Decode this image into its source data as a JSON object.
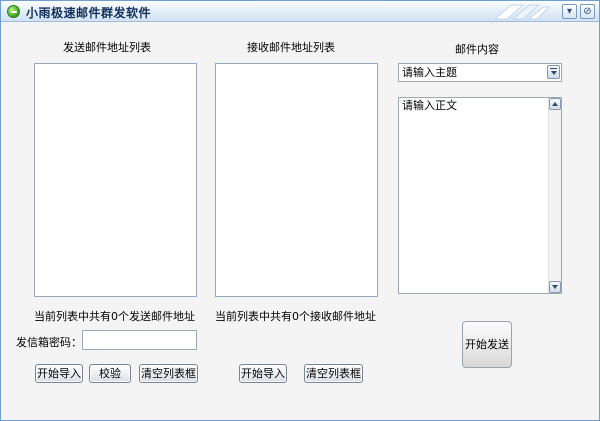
{
  "window": {
    "title": "小雨极速邮件群发软件",
    "minimize_glyph": "▾",
    "close_glyph": "⊘"
  },
  "sender": {
    "header": "发送邮件地址列表",
    "count_text": "当前列表中共有0个发送邮件地址",
    "password_label": "发信箱密码：",
    "password_value": "",
    "import_label": "开始导入",
    "verify_label": "校验",
    "clear_label": "清空列表框"
  },
  "receiver": {
    "header": "接收邮件地址列表",
    "count_text": "当前列表中共有0个接收邮件地址",
    "import_label": "开始导入",
    "clear_label": "清空列表框"
  },
  "content": {
    "header": "邮件内容",
    "subject_placeholder": "请输入主题",
    "body_placeholder": "请输入正文",
    "send_label": "开始发送"
  },
  "icons": {
    "app": "green-chat-icon",
    "minimize": "minimize-icon",
    "close": "close-icon"
  },
  "colors": {
    "titlebar": "#dce8f6",
    "title_text": "#12315a",
    "window_bg": "#f4f4f4",
    "border": "#9aa9b7"
  }
}
